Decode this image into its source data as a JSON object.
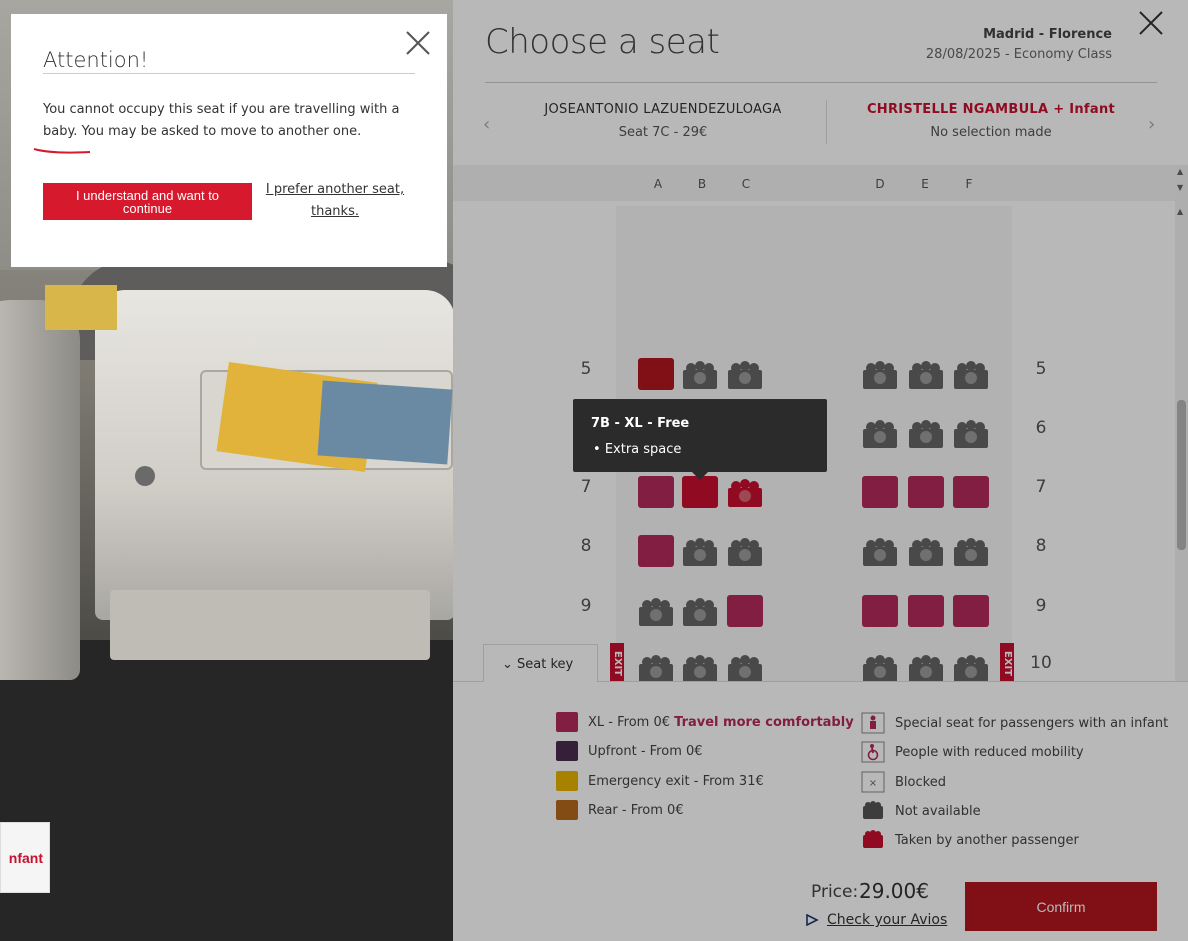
{
  "modal": {
    "title": "Attention!",
    "message": "You cannot occupy this seat if you are travelling with a baby. You may be asked to move to another one.",
    "primary_button": "I understand and want to continue",
    "secondary_link": "I prefer another seat, thanks."
  },
  "cabin": {
    "passenger_chip": "nfant"
  },
  "panel": {
    "title": "Choose a seat",
    "route": "Madrid - Florence",
    "flight_info": "28/08/2025 - Economy Class",
    "passengers": [
      {
        "name": "JOSEANTONIO LAZUENDEZULOAGA",
        "sub": "Seat 7C - 29€"
      },
      {
        "name": "CHRISTELLE NGAMBULA + Infant",
        "sub": "No selection made"
      }
    ],
    "columns": [
      "A",
      "B",
      "C",
      "D",
      "E",
      "F"
    ],
    "rows": [
      "5",
      "6",
      "7",
      "8",
      "9",
      "10"
    ],
    "tooltip": {
      "title": "7B - XL - Free",
      "item": "Extra space"
    },
    "exit_label": "EXIT",
    "seat_key_tab": "Seat key",
    "seat_key": {
      "xl": "XL - From 0€",
      "xl_emph": "Travel more comfortably",
      "upfront": "Upfront - From 0€",
      "emergency": "Emergency exit - From 31€",
      "rear": "Rear - From 0€",
      "infant": "Special seat for passengers with an infant",
      "reduced_mobility": "People with reduced mobility",
      "blocked": "Blocked",
      "not_available": "Not available",
      "taken": "Taken by another passenger"
    },
    "footer": {
      "price_label": "Price:",
      "price": "29.00€",
      "avios": "Check your Avios",
      "confirm": "Confirm"
    }
  },
  "colors": {
    "brand_red": "#c8102e",
    "xl": "#8b1a3e",
    "upfront": "#4b2d4f",
    "emergency": "#e8b400",
    "rear": "#b56a1c"
  }
}
